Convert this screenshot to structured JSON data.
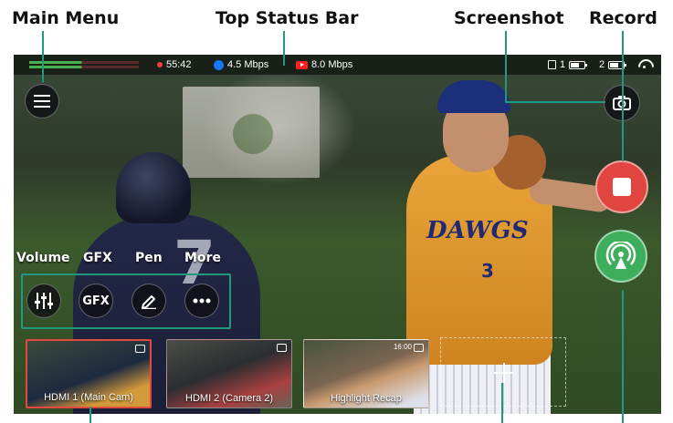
{
  "callouts": {
    "main_menu": "Main Menu",
    "top_status_bar": "Top Status Bar",
    "screenshot": "Screenshot",
    "record": "Record"
  },
  "status_bar": {
    "duration": "55:42",
    "facebook_bitrate": "4.5 Mbps",
    "youtube_bitrate": "8.0 Mbps",
    "slot1": "1",
    "slot2": "2"
  },
  "toolbar": {
    "volume_label": "Volume",
    "gfx_label": "GFX",
    "gfx_button_text": "GFX",
    "pen_label": "Pen",
    "more_label": "More"
  },
  "sources": [
    {
      "label": "HDMI 1 (Main Cam)",
      "selected": true
    },
    {
      "label": "HDMI 2 (Camera 2)",
      "selected": false
    },
    {
      "label": "Highlight Recap",
      "selected": false,
      "time": "16:00"
    }
  ],
  "colors": {
    "accent": "#1f9a7e",
    "record": "#e0463f",
    "stream": "#3fae5c",
    "selected_border": "#e34a3f"
  },
  "icons": {
    "menu": "hamburger-icon",
    "screenshot": "camera-icon",
    "record": "stop-square-icon",
    "stream": "broadcast-icon",
    "volume": "sliders-icon",
    "pen": "pen-icon",
    "more": "dots-icon",
    "add": "plus-icon"
  }
}
